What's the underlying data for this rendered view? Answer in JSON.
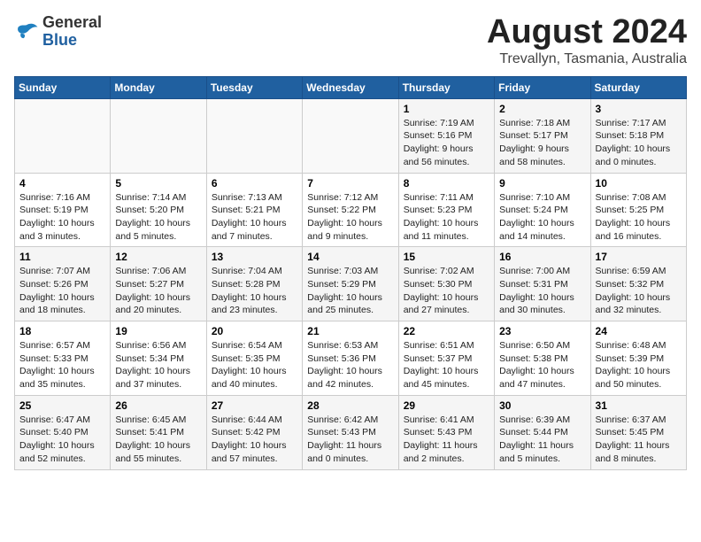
{
  "logo": {
    "general": "General",
    "blue": "Blue"
  },
  "header": {
    "month_year": "August 2024",
    "location": "Trevallyn, Tasmania, Australia"
  },
  "days_of_week": [
    "Sunday",
    "Monday",
    "Tuesday",
    "Wednesday",
    "Thursday",
    "Friday",
    "Saturday"
  ],
  "weeks": [
    [
      {
        "day": "",
        "info": ""
      },
      {
        "day": "",
        "info": ""
      },
      {
        "day": "",
        "info": ""
      },
      {
        "day": "",
        "info": ""
      },
      {
        "day": "1",
        "info": "Sunrise: 7:19 AM\nSunset: 5:16 PM\nDaylight: 9 hours\nand 56 minutes."
      },
      {
        "day": "2",
        "info": "Sunrise: 7:18 AM\nSunset: 5:17 PM\nDaylight: 9 hours\nand 58 minutes."
      },
      {
        "day": "3",
        "info": "Sunrise: 7:17 AM\nSunset: 5:18 PM\nDaylight: 10 hours\nand 0 minutes."
      }
    ],
    [
      {
        "day": "4",
        "info": "Sunrise: 7:16 AM\nSunset: 5:19 PM\nDaylight: 10 hours\nand 3 minutes."
      },
      {
        "day": "5",
        "info": "Sunrise: 7:14 AM\nSunset: 5:20 PM\nDaylight: 10 hours\nand 5 minutes."
      },
      {
        "day": "6",
        "info": "Sunrise: 7:13 AM\nSunset: 5:21 PM\nDaylight: 10 hours\nand 7 minutes."
      },
      {
        "day": "7",
        "info": "Sunrise: 7:12 AM\nSunset: 5:22 PM\nDaylight: 10 hours\nand 9 minutes."
      },
      {
        "day": "8",
        "info": "Sunrise: 7:11 AM\nSunset: 5:23 PM\nDaylight: 10 hours\nand 11 minutes."
      },
      {
        "day": "9",
        "info": "Sunrise: 7:10 AM\nSunset: 5:24 PM\nDaylight: 10 hours\nand 14 minutes."
      },
      {
        "day": "10",
        "info": "Sunrise: 7:08 AM\nSunset: 5:25 PM\nDaylight: 10 hours\nand 16 minutes."
      }
    ],
    [
      {
        "day": "11",
        "info": "Sunrise: 7:07 AM\nSunset: 5:26 PM\nDaylight: 10 hours\nand 18 minutes."
      },
      {
        "day": "12",
        "info": "Sunrise: 7:06 AM\nSunset: 5:27 PM\nDaylight: 10 hours\nand 20 minutes."
      },
      {
        "day": "13",
        "info": "Sunrise: 7:04 AM\nSunset: 5:28 PM\nDaylight: 10 hours\nand 23 minutes."
      },
      {
        "day": "14",
        "info": "Sunrise: 7:03 AM\nSunset: 5:29 PM\nDaylight: 10 hours\nand 25 minutes."
      },
      {
        "day": "15",
        "info": "Sunrise: 7:02 AM\nSunset: 5:30 PM\nDaylight: 10 hours\nand 27 minutes."
      },
      {
        "day": "16",
        "info": "Sunrise: 7:00 AM\nSunset: 5:31 PM\nDaylight: 10 hours\nand 30 minutes."
      },
      {
        "day": "17",
        "info": "Sunrise: 6:59 AM\nSunset: 5:32 PM\nDaylight: 10 hours\nand 32 minutes."
      }
    ],
    [
      {
        "day": "18",
        "info": "Sunrise: 6:57 AM\nSunset: 5:33 PM\nDaylight: 10 hours\nand 35 minutes."
      },
      {
        "day": "19",
        "info": "Sunrise: 6:56 AM\nSunset: 5:34 PM\nDaylight: 10 hours\nand 37 minutes."
      },
      {
        "day": "20",
        "info": "Sunrise: 6:54 AM\nSunset: 5:35 PM\nDaylight: 10 hours\nand 40 minutes."
      },
      {
        "day": "21",
        "info": "Sunrise: 6:53 AM\nSunset: 5:36 PM\nDaylight: 10 hours\nand 42 minutes."
      },
      {
        "day": "22",
        "info": "Sunrise: 6:51 AM\nSunset: 5:37 PM\nDaylight: 10 hours\nand 45 minutes."
      },
      {
        "day": "23",
        "info": "Sunrise: 6:50 AM\nSunset: 5:38 PM\nDaylight: 10 hours\nand 47 minutes."
      },
      {
        "day": "24",
        "info": "Sunrise: 6:48 AM\nSunset: 5:39 PM\nDaylight: 10 hours\nand 50 minutes."
      }
    ],
    [
      {
        "day": "25",
        "info": "Sunrise: 6:47 AM\nSunset: 5:40 PM\nDaylight: 10 hours\nand 52 minutes."
      },
      {
        "day": "26",
        "info": "Sunrise: 6:45 AM\nSunset: 5:41 PM\nDaylight: 10 hours\nand 55 minutes."
      },
      {
        "day": "27",
        "info": "Sunrise: 6:44 AM\nSunset: 5:42 PM\nDaylight: 10 hours\nand 57 minutes."
      },
      {
        "day": "28",
        "info": "Sunrise: 6:42 AM\nSunset: 5:43 PM\nDaylight: 11 hours\nand 0 minutes."
      },
      {
        "day": "29",
        "info": "Sunrise: 6:41 AM\nSunset: 5:43 PM\nDaylight: 11 hours\nand 2 minutes."
      },
      {
        "day": "30",
        "info": "Sunrise: 6:39 AM\nSunset: 5:44 PM\nDaylight: 11 hours\nand 5 minutes."
      },
      {
        "day": "31",
        "info": "Sunrise: 6:37 AM\nSunset: 5:45 PM\nDaylight: 11 hours\nand 8 minutes."
      }
    ]
  ]
}
